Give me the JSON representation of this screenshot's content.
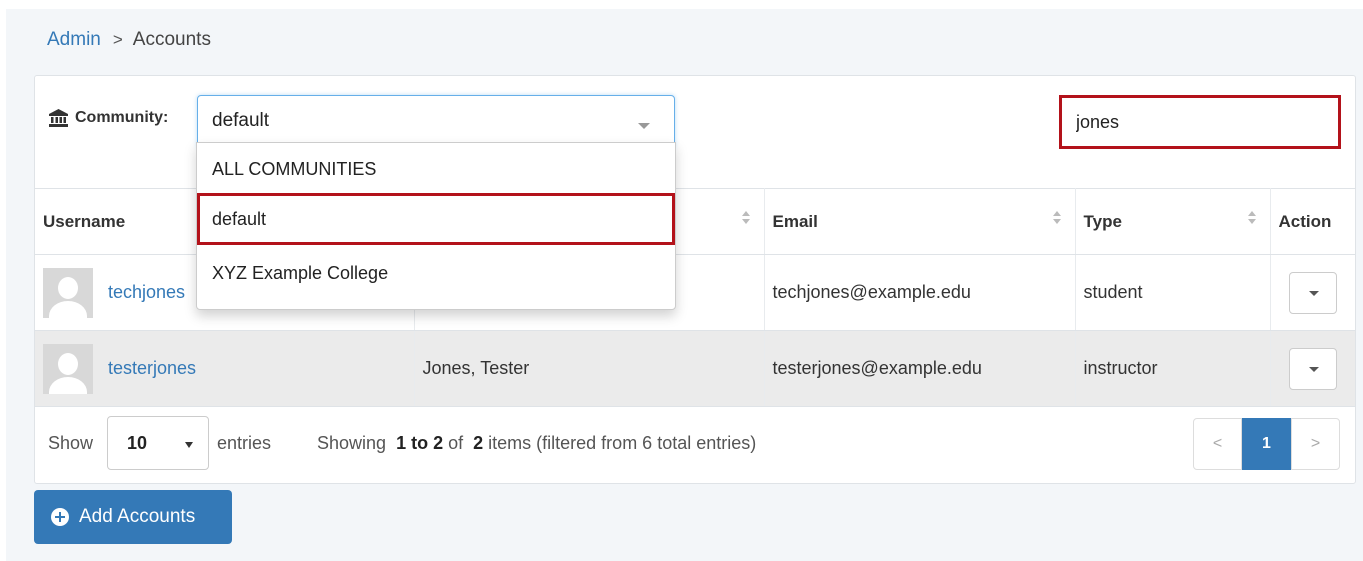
{
  "breadcrumb": {
    "root": "Admin",
    "separator": ">",
    "current": "Accounts"
  },
  "filter": {
    "community_label": "Community:",
    "community_icon": "bank-icon",
    "community_value": "default",
    "search_value": "jones"
  },
  "dropdown": {
    "options": [
      "ALL COMMUNITIES",
      "default",
      "XYZ Example College"
    ],
    "selected": "default"
  },
  "table": {
    "columns": [
      "Username",
      "",
      "Email",
      "Type",
      "Action"
    ],
    "rows": [
      {
        "username": "techjones",
        "name": "",
        "email": "techjones@example.edu",
        "type": "student"
      },
      {
        "username": "testerjones",
        "name": "Jones, Tester",
        "email": "testerjones@example.edu",
        "type": "instructor"
      }
    ]
  },
  "footer": {
    "show_label": "Show",
    "entries_value": "10",
    "entries_label": "entries",
    "info_prefix": "Showing",
    "info_range": "1 to 2",
    "info_of": "of",
    "info_count": "2",
    "info_suffix": "items (filtered from 6 total entries)",
    "pager_prev": "<",
    "pager_page": "1",
    "pager_next": ">"
  },
  "add_button": {
    "label": "Add Accounts",
    "icon": "plus-circle-icon"
  },
  "colors": {
    "accent": "#3479b7",
    "highlight": "#b3121a"
  }
}
